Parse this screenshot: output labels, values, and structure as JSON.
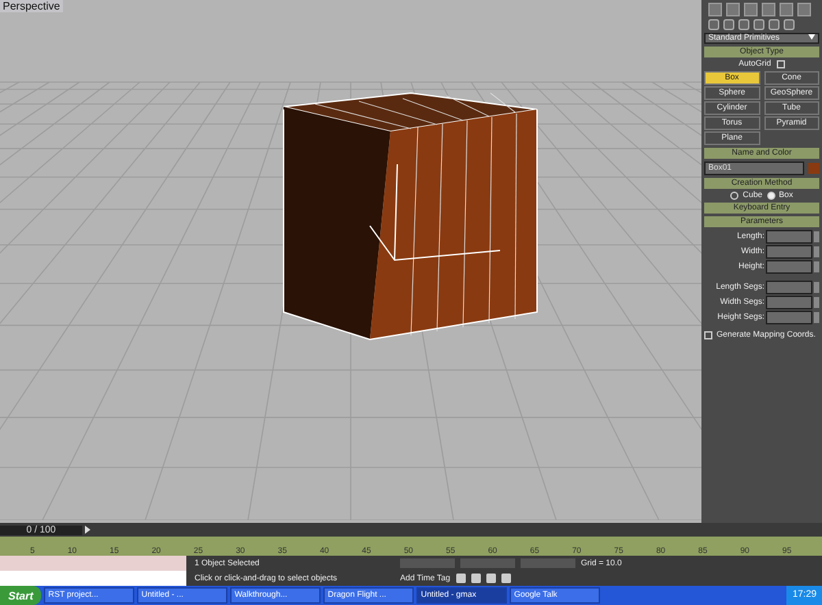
{
  "viewport": {
    "label": "Perspective"
  },
  "command_panel": {
    "dropdown": "Standard Primitives",
    "object_type": {
      "title": "Object Type",
      "autogrid": {
        "label": "AutoGrid",
        "checked": false
      },
      "buttons": [
        {
          "label": "Box",
          "selected": true
        },
        {
          "label": "Cone",
          "selected": false
        },
        {
          "label": "Sphere",
          "selected": false
        },
        {
          "label": "GeoSphere",
          "selected": false
        },
        {
          "label": "Cylinder",
          "selected": false
        },
        {
          "label": "Tube",
          "selected": false
        },
        {
          "label": "Torus",
          "selected": false
        },
        {
          "label": "Pyramid",
          "selected": false
        },
        {
          "label": "Plane",
          "selected": false
        }
      ]
    },
    "name_and_color": {
      "title": "Name and Color",
      "name": "Box01",
      "color": "#8a3a10"
    },
    "creation_method": {
      "title": "Creation Method",
      "options": [
        {
          "label": "Cube",
          "selected": false
        },
        {
          "label": "Box",
          "selected": true
        }
      ]
    },
    "keyboard_entry": {
      "title": "Keyboard Entry"
    },
    "parameters": {
      "title": "Parameters",
      "fields": [
        {
          "label": "Length:"
        },
        {
          "label": "Width:"
        },
        {
          "label": "Height:"
        },
        {
          "label": "Length Segs:"
        },
        {
          "label": "Width Segs:"
        },
        {
          "label": "Height Segs:"
        }
      ],
      "mapping": {
        "label": "Generate Mapping Coords.",
        "checked": false
      }
    }
  },
  "time_slider": {
    "label": "0 / 100",
    "level": 0
  },
  "track_ticks": [
    "5",
    "10",
    "15",
    "20",
    "25",
    "30",
    "35",
    "40",
    "45",
    "50",
    "55",
    "60",
    "65",
    "70",
    "75",
    "80",
    "85",
    "90",
    "95"
  ],
  "status": {
    "selection": "1 Object Selected",
    "prompt": "Click or click-and-drag to select objects",
    "add_time_tag": "Add Time Tag",
    "grid": "Grid = 10.0"
  },
  "taskbar": {
    "start": "Start",
    "items": [
      {
        "label": "RST project...",
        "selected": false
      },
      {
        "label": "Untitled - ...",
        "selected": false
      },
      {
        "label": "Walkthrough...",
        "selected": false
      },
      {
        "label": "Dragon Flight ...",
        "selected": false
      },
      {
        "label": "Untitled - gmax",
        "selected": true
      },
      {
        "label": "Google Talk",
        "selected": false
      }
    ],
    "clock": "17:29"
  }
}
